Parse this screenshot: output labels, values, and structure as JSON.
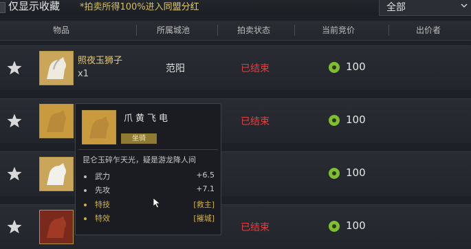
{
  "topbar": {
    "only_favorites": "仅显示收藏",
    "notice_prefix": "*拍卖所得100%进入",
    "notice_highlight": "同盟分红",
    "filter_value": "全部"
  },
  "columns": [
    "物品",
    "所属城池",
    "拍卖状态",
    "当前竞价",
    "出价者"
  ],
  "rows": [
    {
      "name": "照夜玉狮子",
      "qty": "x1",
      "city": "范阳",
      "status": "已结束",
      "price": "100"
    },
    {
      "name": "",
      "qty": "",
      "city": "",
      "status": "已结束",
      "price": "100"
    },
    {
      "name": "",
      "qty": "",
      "city": "",
      "status": "",
      "price": "100"
    },
    {
      "name": "",
      "qty": "",
      "city": "",
      "status": "已结束",
      "price": "100"
    }
  ],
  "tooltip": {
    "name": "爪黄飞电",
    "tag": "坐骑",
    "desc": "昆仑玉碎乍天光，疑是游龙降人间",
    "stats": [
      {
        "label": "武力",
        "value": "+6.5"
      },
      {
        "label": "先攻",
        "value": "+7.1"
      },
      {
        "label": "特技",
        "value": "[救主]"
      },
      {
        "label": "特效",
        "value": "[摧城]"
      }
    ]
  },
  "colors": {
    "status_red": "#e24040",
    "gold": "#e6c873",
    "coin_green": "#7fbf2f"
  },
  "icons": [
    "star-icon",
    "coin-icon",
    "chevron-down-icon",
    "horse-thumbnail",
    "cursor-icon"
  ]
}
